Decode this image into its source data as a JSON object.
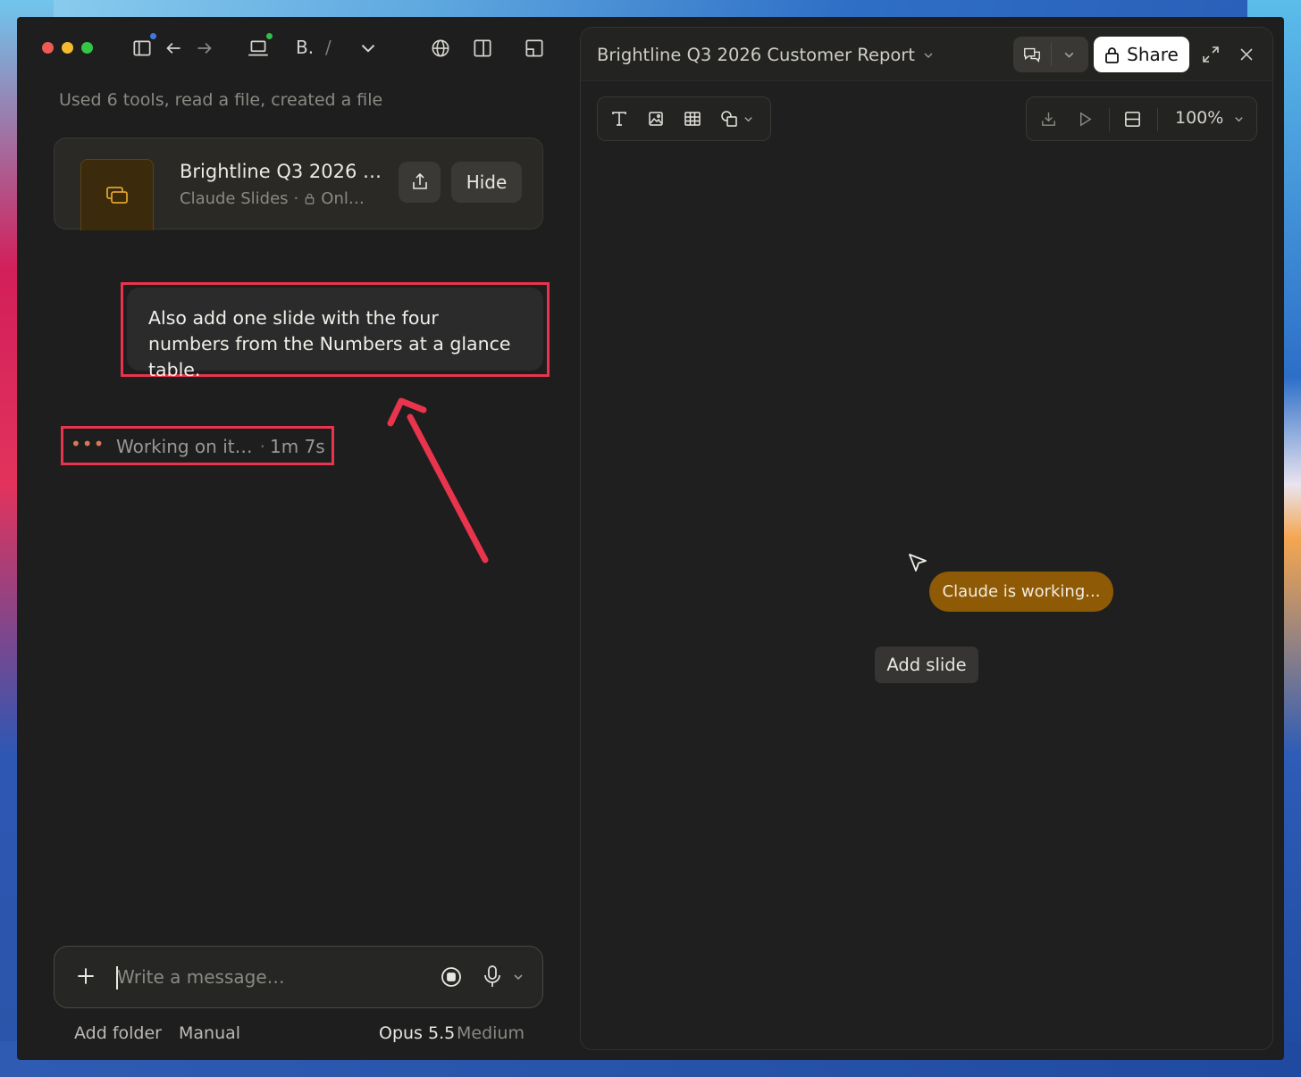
{
  "left_panel": {
    "tools_summary": "Used 6 tools, read a file, created a file",
    "breadcrumb": {
      "first": "B.",
      "separator": "/"
    },
    "file_card": {
      "title": "Brightline Q3 2026 …",
      "app": "Claude Slides",
      "visibility": "Onl…",
      "hide_label": "Hide"
    },
    "user_message": "Also add one slide with the four numbers from the Numbers at a glance table.",
    "status": {
      "text": "Working on it…",
      "separator": "·",
      "elapsed": "1m 7s"
    },
    "composer": {
      "placeholder": "Write a message…",
      "value": ""
    },
    "footer": {
      "add_folder": "Add folder",
      "mode": "Manual",
      "model": "Opus 5.5",
      "effort": "Medium"
    }
  },
  "right_panel": {
    "doc_title": "Brightline Q3 2026 Customer Report",
    "share_label": "Share",
    "zoom": "100%",
    "working_pill": "Claude is working...",
    "add_slide_label": "Add slide"
  },
  "colors": {
    "highlight": "#e8344d",
    "working_pill": "#8f5a05",
    "status_dots": "#d97757"
  }
}
